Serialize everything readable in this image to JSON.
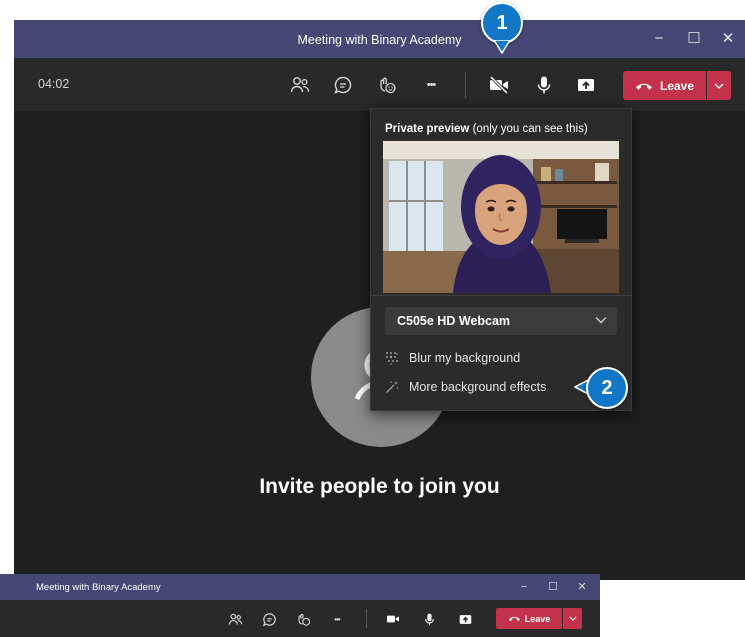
{
  "window": {
    "title": "Meeting with Binary Academy",
    "minimize_glyph": "−",
    "maximize_glyph": "☐",
    "close_glyph": "✕"
  },
  "toolbar": {
    "timer": "04:02",
    "icons": [
      "people-icon",
      "chat-icon",
      "reactions-icon",
      "more-options-icon",
      "camera-off-icon",
      "microphone-icon",
      "share-screen-icon"
    ],
    "more_glyph": "•••",
    "leave_label": "Leave",
    "leave_color": "#c4314b"
  },
  "main": {
    "invite_text": "Invite people to join you"
  },
  "camera_popup": {
    "preview_bold": "Private preview",
    "preview_note": "(only you can see this)",
    "camera_device": "C505e HD Webcam",
    "blur_label": "Blur my background",
    "effects_label": "More background effects"
  },
  "callouts": {
    "step1": "1",
    "step2": "2",
    "color": "#1177c6"
  },
  "second_window": {
    "title": "Meeting with Binary Academy",
    "more_glyph": "•••",
    "leave_label": "Leave"
  },
  "colors": {
    "titlebar": "#464775",
    "toolbar": "#292929",
    "stage": "#1f1f1f"
  }
}
